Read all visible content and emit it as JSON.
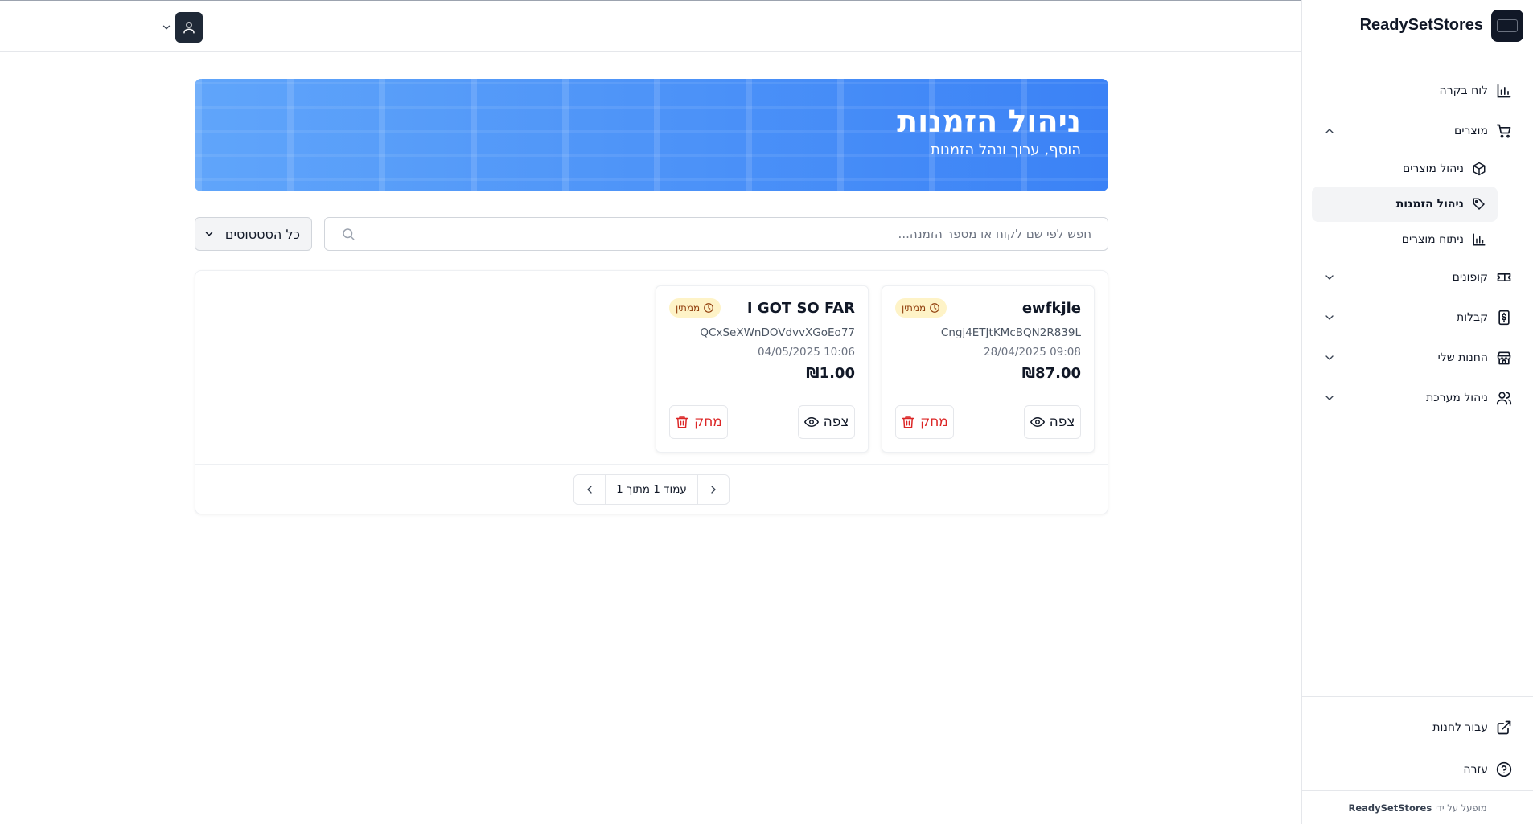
{
  "brand": {
    "name": "ReadySetStores"
  },
  "sidebar": {
    "items": [
      {
        "label": "לוח בקרה",
        "icon": "bar-chart-icon"
      },
      {
        "label": "מוצרים",
        "icon": "shopping-cart-icon",
        "expanded": true,
        "children": [
          {
            "label": "ניהול מוצרים",
            "icon": "box-icon"
          },
          {
            "label": "ניהול הזמנות",
            "icon": "tag-icon",
            "active": true
          },
          {
            "label": "ניתוח מוצרים",
            "icon": "bar-chart-icon"
          }
        ]
      },
      {
        "label": "קופונים",
        "icon": "ticket-icon"
      },
      {
        "label": "קבלות",
        "icon": "receipt-dollar-icon"
      },
      {
        "label": "החנות שלי",
        "icon": "store-icon"
      },
      {
        "label": "ניהול מערכת",
        "icon": "users-icon"
      }
    ],
    "bottom": [
      {
        "label": "עבור לחנות",
        "icon": "external-link-icon"
      },
      {
        "label": "עזרה",
        "icon": "help-circle-icon"
      }
    ],
    "footer_prefix": "מופעל על ידי",
    "footer_brand": "ReadySetStores"
  },
  "banner": {
    "title": "ניהול הזמנות",
    "subtitle": "הוסף, ערוך ונהל הזמנות"
  },
  "filters": {
    "search_placeholder": "חפש לפי שם לקוח או מספר הזמנה...",
    "status_selected": "כל הסטטוסים"
  },
  "orders": [
    {
      "customer": "ewfkjle",
      "status": "ממתין",
      "order_id": "Cngj4ETJtKMcBQN2R839L",
      "date": "28/04/2025 09:08",
      "total": "₪87.00",
      "view_label": "צפה",
      "delete_label": "מחק"
    },
    {
      "customer": "I GOT SO FAR",
      "status": "ממתין",
      "order_id": "QCxSeXWnDOVdvvXGoEo77",
      "date": "04/05/2025 10:06",
      "total": "₪1.00",
      "view_label": "צפה",
      "delete_label": "מחק"
    }
  ],
  "pagination": {
    "text": "עמוד 1 מתוך 1"
  },
  "colors": {
    "banner_start": "#60a5fa",
    "banner_end": "#3b82f6",
    "pending_badge_bg": "#fef3c7",
    "pending_badge_text": "#92400e",
    "delete_red": "#dc2626"
  }
}
